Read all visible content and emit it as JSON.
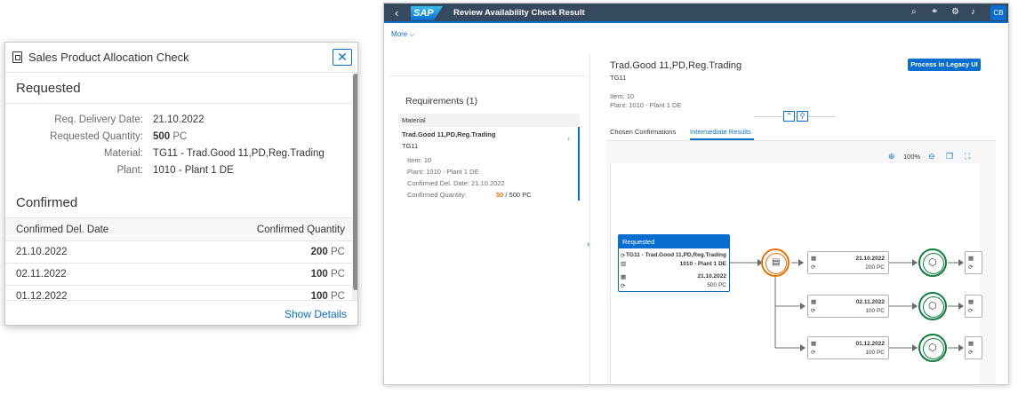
{
  "dialog": {
    "title": "Sales Product Allocation Check",
    "close_label": "✕",
    "requested": {
      "title": "Requested",
      "fields": [
        {
          "label": "Req. Delivery Date:",
          "value": "21.10.2022"
        },
        {
          "label": "Requested Quantity:",
          "value": "500",
          "unit": "PC"
        },
        {
          "label": "Material:",
          "value": "TG11 - Trad.Good 11,PD,Reg.Trading"
        },
        {
          "label": "Plant:",
          "value": "1010 - Plant 1 DE"
        }
      ]
    },
    "confirmed": {
      "title": "Confirmed",
      "columns": [
        "Confirmed Del. Date",
        "Confirmed Quantity"
      ],
      "rows": [
        {
          "date": "21.10.2022",
          "qty": "200",
          "unit": "PC"
        },
        {
          "date": "02.11.2022",
          "qty": "100",
          "unit": "PC"
        },
        {
          "date": "01.12.2022",
          "qty": "100",
          "unit": "PC"
        }
      ]
    },
    "show_details": "Show Details"
  },
  "shell": {
    "logo_text": "SAP",
    "title": "Review Availability Check Result",
    "avatar": "CB"
  },
  "more_label": "More ⌵",
  "requirements": {
    "title": "Requirements (1)",
    "column": "Material",
    "item": {
      "name": "Trad.Good 11,PD,Reg.Trading",
      "code": "TG11",
      "item": "Item:  10",
      "plant": "Plant:  1010 - Plant 1 DE",
      "del_date": "Confirmed Del. Date:  21.10.2022",
      "qty_label": "Confirmed Quantity:",
      "qty_confirmed": "50",
      "qty_rest": " / 500 PC"
    }
  },
  "object": {
    "title": "Trad.Good 11,PD,Reg.Trading",
    "subtitle": "TG11",
    "item": "Item: 10",
    "plant": "Plant: 1010 - Plant 1 DE",
    "legacy_button": "Process in Legacy UI",
    "tabs": [
      "Chosen Confirmations",
      "Intermediate Results"
    ],
    "zoom": "100%"
  },
  "graph": {
    "requested": {
      "header": "Requested",
      "material": "TG11 - Trad.Good 11,PD,Reg.Trading",
      "plant": "1010 - Plant 1 DE",
      "date": "21.10.2022",
      "qty": "500 PC"
    },
    "results": [
      {
        "date": "21.10.2022",
        "qty": "200 PC"
      },
      {
        "date": "02.11.2022",
        "qty": "100 PC"
      },
      {
        "date": "01.12.2022",
        "qty": "100 PC"
      }
    ]
  }
}
